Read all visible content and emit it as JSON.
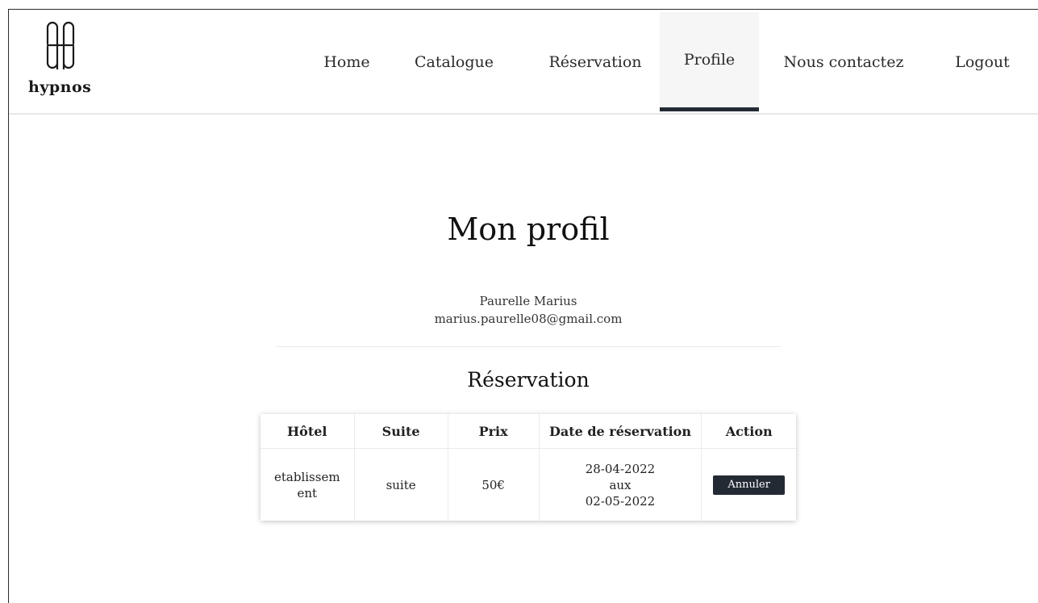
{
  "brand": {
    "logo_text": "hypnos"
  },
  "nav": {
    "home": "Home",
    "catalogue": "Catalogue",
    "reservation": "Réservation",
    "profile": "Profile",
    "contact": "Nous contactez",
    "logout": "Logout",
    "active": "Profile"
  },
  "profile": {
    "title": "Mon profil",
    "name": "Paurelle Marius",
    "email": "marius.paurelle08@gmail.com"
  },
  "reservations": {
    "title": "Réservation",
    "headers": [
      "Hôtel",
      "Suite",
      "Prix",
      "Date de réservation",
      "Action"
    ],
    "rows": [
      {
        "hotel": "etablissement",
        "hotel_line1": "etablissem",
        "hotel_line2": "ent",
        "suite": "suite",
        "price": "50€",
        "date_from": "28-04-2022",
        "date_sep": "aux",
        "date_to": "02-05-2022",
        "action": "Annuler"
      }
    ]
  },
  "colors": {
    "accent": "#232a33",
    "nav_active_bg": "#f6f6f6"
  }
}
